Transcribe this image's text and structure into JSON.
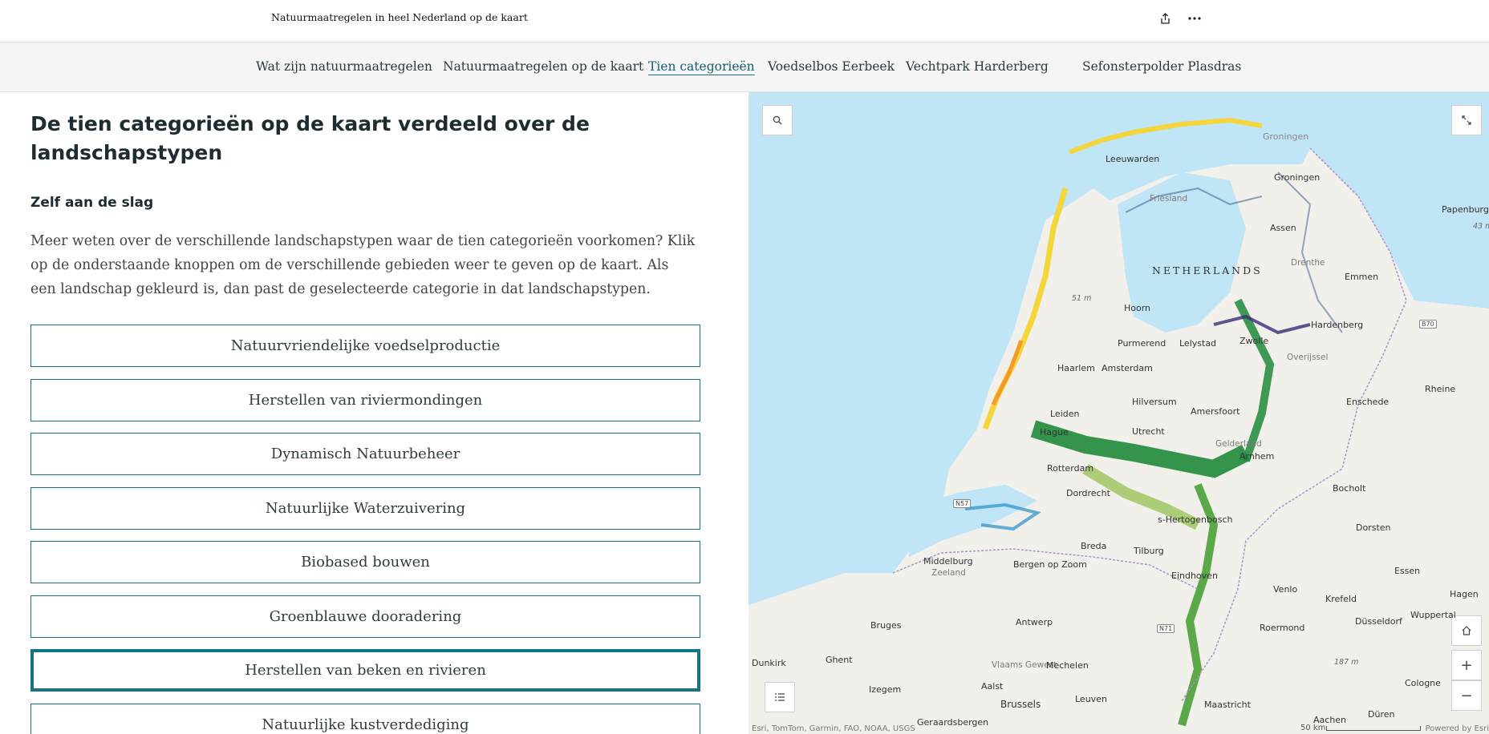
{
  "header": {
    "title": "Natuurmaatregelen in heel Nederland op de kaart",
    "share_icon": "share-icon",
    "more_icon": "more-icon"
  },
  "nav": {
    "items": [
      {
        "label": "Wat zijn natuurmaatregelen"
      },
      {
        "label": "Natuurmaatregelen op de kaart"
      },
      {
        "label": "Tien categorieën",
        "active": true
      },
      {
        "label": "Voedselbos Eerbeek"
      },
      {
        "label": "Vechtpark Harderberg"
      },
      {
        "label": "Sefonsterpolder Plasdras"
      }
    ]
  },
  "content": {
    "title": "De tien categorieën op de kaart verdeeld over de landschapstypen",
    "subtitle": "Zelf aan de slag",
    "intro": "Meer weten over de verschillende landschapstypen waar de tien categorieën voorkomen? Klik op de onderstaande knoppen om de verschillende gebieden weer te geven op de kaart. Als een landschap gekleurd is, dan past de geselecteerde categorie in dat landschapstypen.",
    "buttons": [
      {
        "label": "Natuurvriendelijke voedselproductie"
      },
      {
        "label": "Herstellen van riviermondingen"
      },
      {
        "label": "Dynamisch Natuurbeheer"
      },
      {
        "label": "Natuurlijke Waterzuivering"
      },
      {
        "label": "Biobased bouwen"
      },
      {
        "label": "Groenblauwe dooradering"
      },
      {
        "label": "Herstellen van beken en rivieren",
        "selected": true
      },
      {
        "label": "Natuurlijke kustverdediging"
      }
    ]
  },
  "map": {
    "country_label": "NETHERLANDS",
    "cities": [
      "Groningen",
      "Leeuwarden",
      "Groningen",
      "Papenburg",
      "Assen",
      "Emmen",
      "Hoorn",
      "Purmerend",
      "Lelystad",
      "Zwolle",
      "Hardenberg",
      "Haarlem",
      "Amsterdam",
      "Hilversum",
      "Amersfoort",
      "Enschede",
      "Rheine",
      "Leiden",
      "Utrecht",
      "Hague",
      "Arnhem",
      "Rotterdam",
      "Dordrecht",
      "Bocholt",
      "s-Hertogenbosch",
      "Breda",
      "Tilburg",
      "Dorsten",
      "Middelburg",
      "Bergen op Zoom",
      "Eindhoven",
      "Essen",
      "Venlo",
      "Krefeld",
      "Hagen",
      "Wuppertal",
      "Düsseldorf",
      "Bruges",
      "Antwerp",
      "Roermond",
      "Dunkirk",
      "Ghent",
      "Mechelen",
      "Izegem",
      "Aalst",
      "Brussels",
      "Leuven",
      "Cologne",
      "Maastricht",
      "Aachen",
      "Düren",
      "Geraardsbergen"
    ],
    "provinces": [
      "Friesland",
      "Drenthe",
      "Overijssel",
      "Gelderland",
      "Zeeland",
      "Vlaams Gewest"
    ],
    "elevations": [
      "43 m",
      "51 m",
      "187 m"
    ],
    "roads": [
      "B70",
      "N57",
      "N71"
    ],
    "attribution": "Esri, TomTom, Garmin, FAO, NOAA, USGS",
    "powered_by": "Powered by Esri",
    "scale": "50 km",
    "colors": {
      "water": "#bfe5f7",
      "land": "#f1f0eb",
      "river_green": "#1f8a3a",
      "coast_yellow": "#f4d53a",
      "accent": "#157387"
    }
  }
}
